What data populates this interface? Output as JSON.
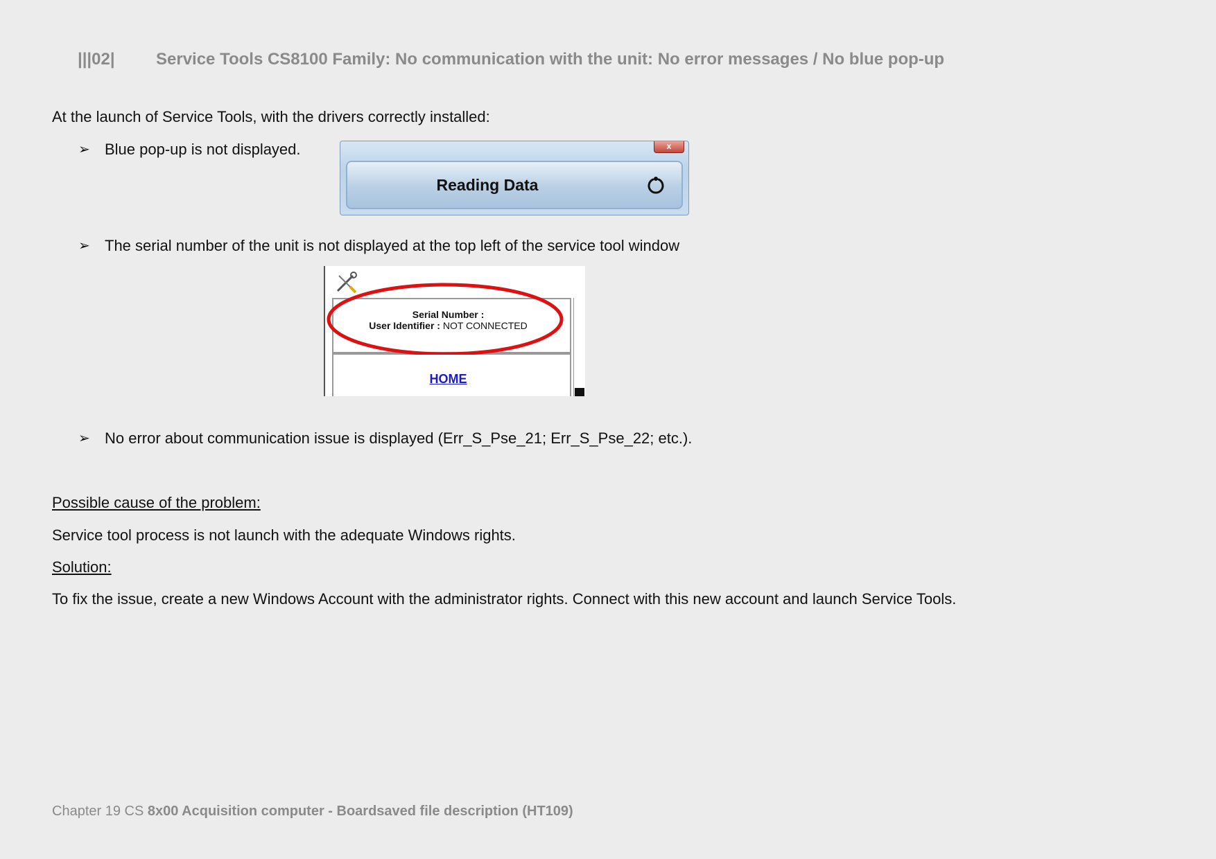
{
  "header": {
    "number": "|||02|",
    "title": "Service Tools CS8100 Family: No communication with the unit: No error messages / No blue pop-up"
  },
  "intro": "At the launch of Service Tools, with the drivers correctly installed:",
  "bullets": [
    "Blue pop-up is not displayed.",
    "The serial number of the unit is not displayed at the top left of the service tool window",
    "No error about communication issue is displayed (Err_S_Pse_21; Err_S_Pse_22; etc.)."
  ],
  "bullet_mark": "➢",
  "popup": {
    "close_label": "x",
    "label": "Reading Data"
  },
  "serial_panel": {
    "serial_label": "Serial Number :",
    "user_label": "User Identifier :",
    "user_value": "NOT CONNECTED",
    "home_link": "HOME"
  },
  "cause_heading": "Possible cause of the problem:",
  "cause_text": "Service tool process is not launch with the adequate Windows rights.",
  "solution_heading": "Solution:",
  "solution_text": "To fix the issue, create a new Windows Account with the administrator rights. Connect with this new account and launch Service Tools.",
  "footer": {
    "prefix": "Chapter 19 CS ",
    "bold": "8x00 Acquisition computer - Boardsaved file description (HT109)"
  }
}
